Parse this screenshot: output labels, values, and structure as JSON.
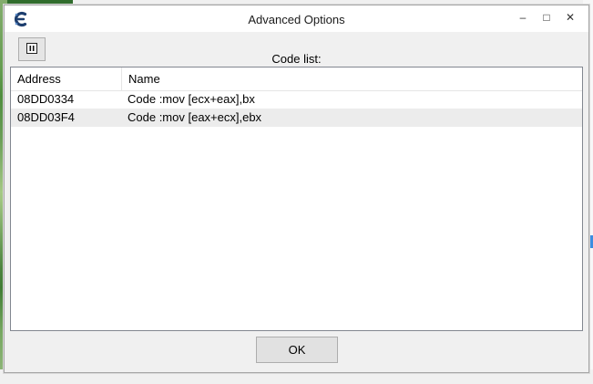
{
  "dialog": {
    "title": "Advanced Options",
    "code_list_label": "Code list:",
    "ok_label": "OK",
    "window_controls": {
      "minimize": "–",
      "maximize": "□",
      "close": "✕"
    }
  },
  "code_list": {
    "columns": [
      "Address",
      "Name"
    ],
    "rows": [
      {
        "address": "08DD0334",
        "name": "Code :mov [ecx+eax],bx"
      },
      {
        "address": "08DD03F4",
        "name": "Code :mov [eax+ecx],ebx"
      }
    ]
  },
  "icons": {
    "app": "cheat-engine-icon",
    "pause": "pause-icon"
  },
  "colors": {
    "dialog_bg": "#f0f0f0",
    "list_bg": "#ffffff",
    "row_alt": "#ececec",
    "accent_blue": "#3c8de0"
  }
}
